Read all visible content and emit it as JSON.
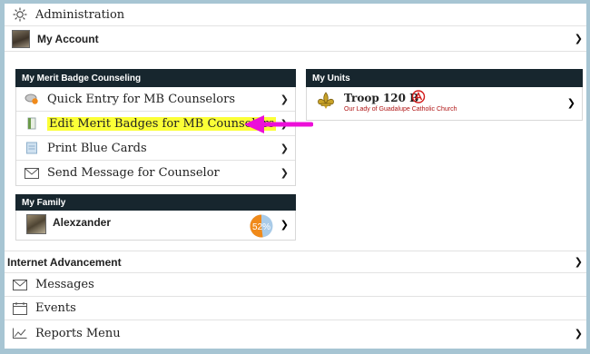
{
  "top": {
    "admin_label": "Administration",
    "account_label": "My Account"
  },
  "mb_panel": {
    "title": "My Merit Badge Counseling",
    "items": [
      {
        "label": "Quick Entry for MB Counselors",
        "icon": "merit-badge-icon"
      },
      {
        "label": "Edit Merit Badges for MB Counselors",
        "icon": "badge-sash-icon",
        "highlighted": true
      },
      {
        "label": "Print Blue Cards",
        "icon": "card-icon"
      },
      {
        "label": "Send Message for Counselor",
        "icon": "envelope-icon"
      }
    ]
  },
  "units_panel": {
    "title": "My Units",
    "unit_name": "Troop 120 B",
    "unit_sub": "Our Lady of Guadalupe Catholic Church"
  },
  "family_panel": {
    "title": "My Family",
    "member_name": "Alexzander",
    "progress_label": "52%",
    "progress": 0.52
  },
  "bottom": {
    "internet_advancement": "Internet Advancement",
    "messages": "Messages",
    "events": "Events",
    "reports_menu": "Reports Menu"
  },
  "colors": {
    "header_bg": "#17262e",
    "highlight": "#fbff37",
    "arrow": "#ec0fd8",
    "unit_sub_text": "#b01515",
    "page_bg": "#a7c5d3"
  }
}
